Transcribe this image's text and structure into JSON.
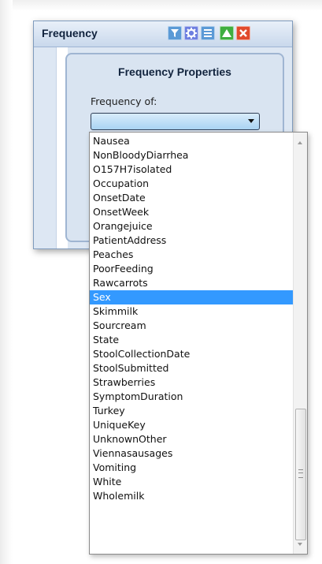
{
  "gadget": {
    "title": "Frequency",
    "buttons": [
      {
        "name": "filter-icon",
        "color": "#5b9ad6"
      },
      {
        "name": "gear-icon",
        "color": "#6d7fe0"
      },
      {
        "name": "menu-icon",
        "color": "#5b9ad6"
      },
      {
        "name": "maximize-icon",
        "color": "#3fae40"
      },
      {
        "name": "close-icon",
        "color": "#e14a2c"
      }
    ]
  },
  "properties": {
    "title": "Frequency Properties",
    "frequency_of_label": "Frequency of:",
    "combo_value": ""
  },
  "dropdown": {
    "selected": "Sex",
    "items": [
      "Nausea",
      "NonBloodyDiarrhea",
      "O157H7isolated",
      "Occupation",
      "OnsetDate",
      "OnsetWeek",
      "Orangejuice",
      "PatientAddress",
      "Peaches",
      "PoorFeeding",
      "Rawcarrots",
      "Sex",
      "Skimmilk",
      "Sourcream",
      "State",
      "StoolCollectionDate",
      "StoolSubmitted",
      "Strawberries",
      "SymptomDuration",
      "Turkey",
      "UniqueKey",
      "UnknownOther",
      "Viennasausages",
      "Vomiting",
      "White",
      "Wholemilk"
    ]
  },
  "colors": {
    "selection": "#3399ff",
    "panel": "#d9e4f1"
  }
}
